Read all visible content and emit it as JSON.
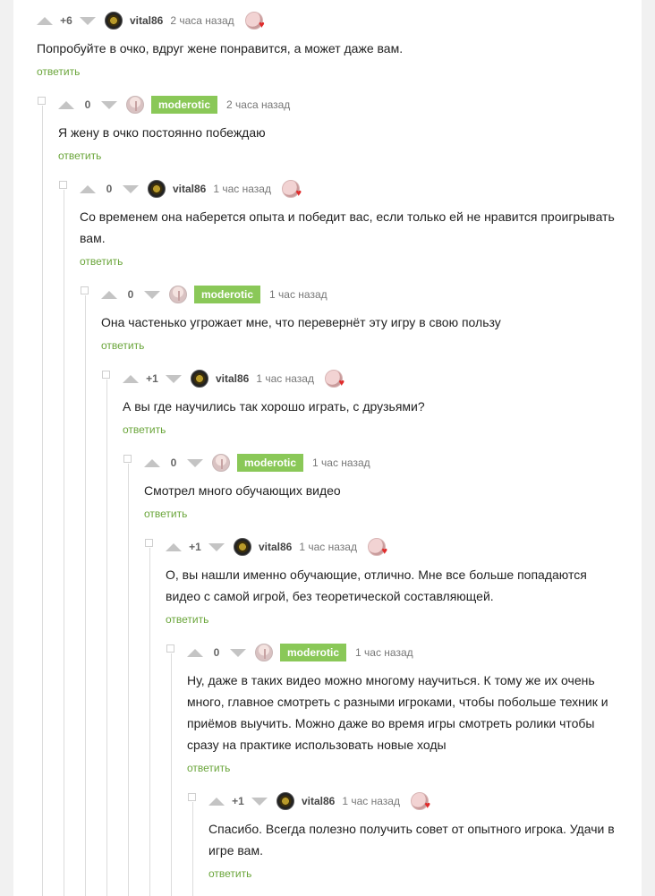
{
  "reply_label": "ответить",
  "comments": [
    {
      "rating": "+6",
      "user": "vital86",
      "badge": false,
      "time": "2 часа назад",
      "text": "Попробуйте в очко, вдруг жене понравится, а может даже вам."
    },
    {
      "rating": "0",
      "user": "moderotic",
      "badge": true,
      "time": "2 часа назад",
      "text": "Я жену в очко постоянно побеждаю"
    },
    {
      "rating": "0",
      "user": "vital86",
      "badge": false,
      "time": "1 час назад",
      "text": "Со временем она наберется опыта и победит вас, если только ей не нравится проигрывать вам."
    },
    {
      "rating": "0",
      "user": "moderotic",
      "badge": true,
      "time": "1 час назад",
      "text": "Она частенько угрожает мне, что перевернёт эту игру в свою пользу"
    },
    {
      "rating": "+1",
      "user": "vital86",
      "badge": false,
      "time": "1 час назад",
      "text": "А вы где научились так хорошо играть, с друзьями?"
    },
    {
      "rating": "0",
      "user": "moderotic",
      "badge": true,
      "time": "1 час назад",
      "text": "Смотрел много обучающих видео"
    },
    {
      "rating": "+1",
      "user": "vital86",
      "badge": false,
      "time": "1 час назад",
      "text": "О, вы нашли именно обучающие, отлично. Мне все больше попадаются видео с самой игрой, без теоретической составляющей."
    },
    {
      "rating": "0",
      "user": "moderotic",
      "badge": true,
      "time": "1 час назад",
      "text": "Ну, даже в таких видео можно многому научиться. К тому же их очень много, главное смотреть с разными игроками, чтобы побольше техник и приёмов выучить. Можно даже во время игры смотреть ролики чтобы сразу на практике использовать новые ходы"
    },
    {
      "rating": "+1",
      "user": "vital86",
      "badge": false,
      "time": "1 час назад",
      "text": "Спасибо. Всегда полезно получить совет от опытного игрока. Удачи в игре вам."
    }
  ]
}
